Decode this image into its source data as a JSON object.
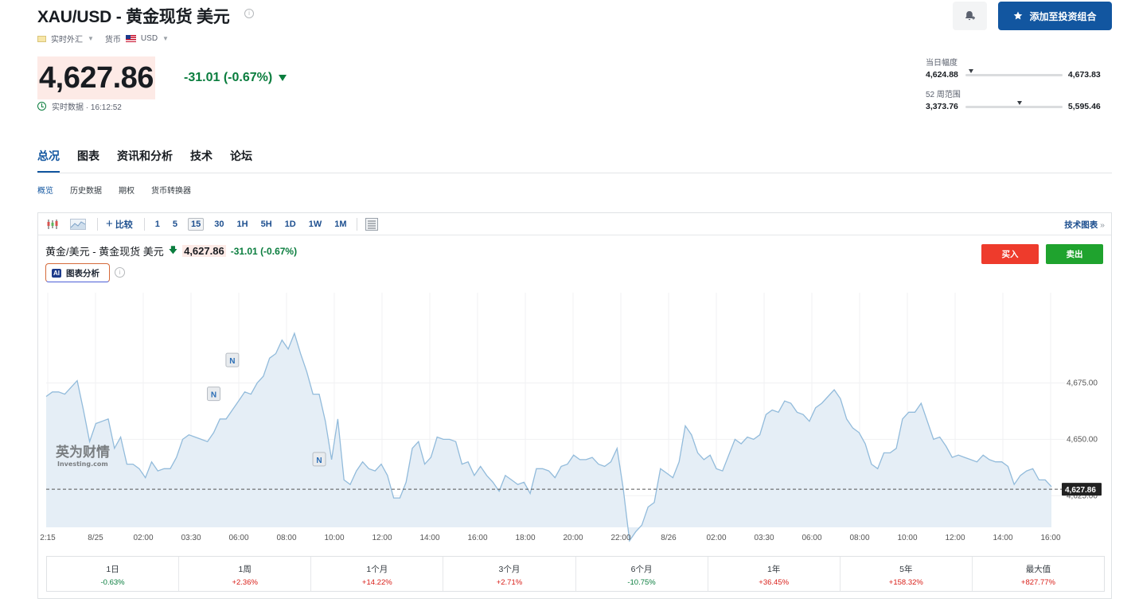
{
  "header": {
    "title": "XAU/USD - 黄金现货 美元",
    "market_type": "实时外汇",
    "currency_label": "货币",
    "currency": "USD",
    "price": "4,627.86",
    "change": "-31.01 (-0.67%)",
    "realtime": "实时数据 · 16:12:52",
    "add_portfolio": "添加至投资组合"
  },
  "ranges": {
    "day_label": "当日幅度",
    "day_low": "4,624.88",
    "day_high": "4,673.83",
    "day_position": 0.06,
    "week52_label": "52 周范围",
    "week52_low": "3,373.76",
    "week52_high": "5,595.46",
    "week52_position": 0.56
  },
  "tabs": [
    "总况",
    "图表",
    "资讯和分析",
    "技术",
    "论坛"
  ],
  "subtabs": [
    "概览",
    "历史数据",
    "期权",
    "货币转换器"
  ],
  "toolbar": {
    "compare": "比较",
    "periods": [
      "1",
      "5",
      "15",
      "30",
      "1H",
      "5H",
      "1D",
      "1W",
      "1M"
    ],
    "selected_period": "15",
    "tech_chart": "技术图表"
  },
  "chart_header": {
    "name": "黄金/美元 - 黄金现货 美元",
    "price": "4,627.86",
    "change": "-31.01 (-0.67%)",
    "ai_badge": "AI",
    "ai_label": "图表分析",
    "buy": "买入",
    "sell": "卖出",
    "watermark_cn": "英为财情",
    "watermark_en": "Investing.com",
    "news_marker": "N"
  },
  "chart_data": {
    "type": "area",
    "x_tick_labels": [
      "2:15",
      "8/25",
      "02:00",
      "03:30",
      "06:00",
      "08:00",
      "10:00",
      "12:00",
      "14:00",
      "16:00",
      "18:00",
      "20:00",
      "22:00",
      "8/26",
      "02:00",
      "03:30",
      "06:00",
      "08:00",
      "10:00",
      "12:00",
      "14:00",
      "16:00"
    ],
    "y_ticks": [
      4675,
      4650,
      4625
    ],
    "y_tick_labels": [
      "4,675.00",
      "4,650.00",
      "4,625.00"
    ],
    "ylim": [
      4611,
      4715
    ],
    "last_price": 4627.86,
    "last_price_label": "4,627.86",
    "values": [
      4669,
      4671,
      4671,
      4670,
      4673,
      4676,
      4663,
      4649,
      4657,
      4658,
      4659,
      4646,
      4651,
      4639,
      4639,
      4637,
      4633,
      4640,
      4636,
      4637,
      4637,
      4642,
      4650,
      4652,
      4651,
      4650,
      4649,
      4653,
      4659,
      4659,
      4663,
      4667,
      4671,
      4670,
      4675,
      4678,
      4686,
      4688,
      4694,
      4690,
      4697,
      4688,
      4680,
      4670,
      4670,
      4658,
      4641,
      4659,
      4632,
      4630,
      4636,
      4640,
      4637,
      4636,
      4639,
      4634,
      4624,
      4624,
      4631,
      4646,
      4649,
      4639,
      4642,
      4651,
      4650,
      4650,
      4649,
      4639,
      4640,
      4634,
      4638,
      4634,
      4631,
      4627,
      4634,
      4632,
      4630,
      4631,
      4626,
      4637,
      4637,
      4636,
      4633,
      4638,
      4639,
      4643,
      4641,
      4641,
      4642,
      4639,
      4638,
      4640,
      4646,
      4628,
      4605,
      4609,
      4612,
      4620,
      4622,
      4637,
      4635,
      4633,
      4640,
      4656,
      4652,
      4644,
      4641,
      4643,
      4637,
      4636,
      4643,
      4650,
      4648,
      4651,
      4650,
      4652,
      4661,
      4663,
      4662,
      4667,
      4666,
      4662,
      4661,
      4658,
      4664,
      4666,
      4669,
      4672,
      4668,
      4659,
      4655,
      4653,
      4648,
      4639,
      4637,
      4644,
      4644,
      4646,
      4659,
      4662,
      4662,
      4666,
      4658,
      4650,
      4651,
      4647,
      4642,
      4643,
      4642,
      4641,
      4640,
      4643,
      4641,
      4640,
      4640,
      4638,
      4630,
      4634,
      4636,
      4637,
      4632,
      4632,
      4629
    ],
    "news_markers": [
      {
        "x_index": 27,
        "y": 4670
      },
      {
        "x_index": 30,
        "y": 4685
      },
      {
        "x_index": 44,
        "y": 4641
      }
    ]
  },
  "performance": [
    {
      "label": "1日",
      "value": "-0.63%",
      "sign": "neg"
    },
    {
      "label": "1周",
      "value": "+2.36%",
      "sign": "pos"
    },
    {
      "label": "1个月",
      "value": "+14.22%",
      "sign": "pos"
    },
    {
      "label": "3个月",
      "value": "+2.71%",
      "sign": "pos"
    },
    {
      "label": "6个月",
      "value": "-10.75%",
      "sign": "neg"
    },
    {
      "label": "1年",
      "value": "+36.45%",
      "sign": "pos"
    },
    {
      "label": "5年",
      "value": "+158.32%",
      "sign": "pos"
    },
    {
      "label": "最大值",
      "value": "+827.77%",
      "sign": "pos"
    }
  ],
  "colors": {
    "accent": "#1256a0",
    "down": "#0a7d3e",
    "up": "#d91e18",
    "buy": "#ee3b2c",
    "sell": "#1fa32e",
    "chart_line": "#92bbdb",
    "chart_fill": "#e5eef6"
  }
}
